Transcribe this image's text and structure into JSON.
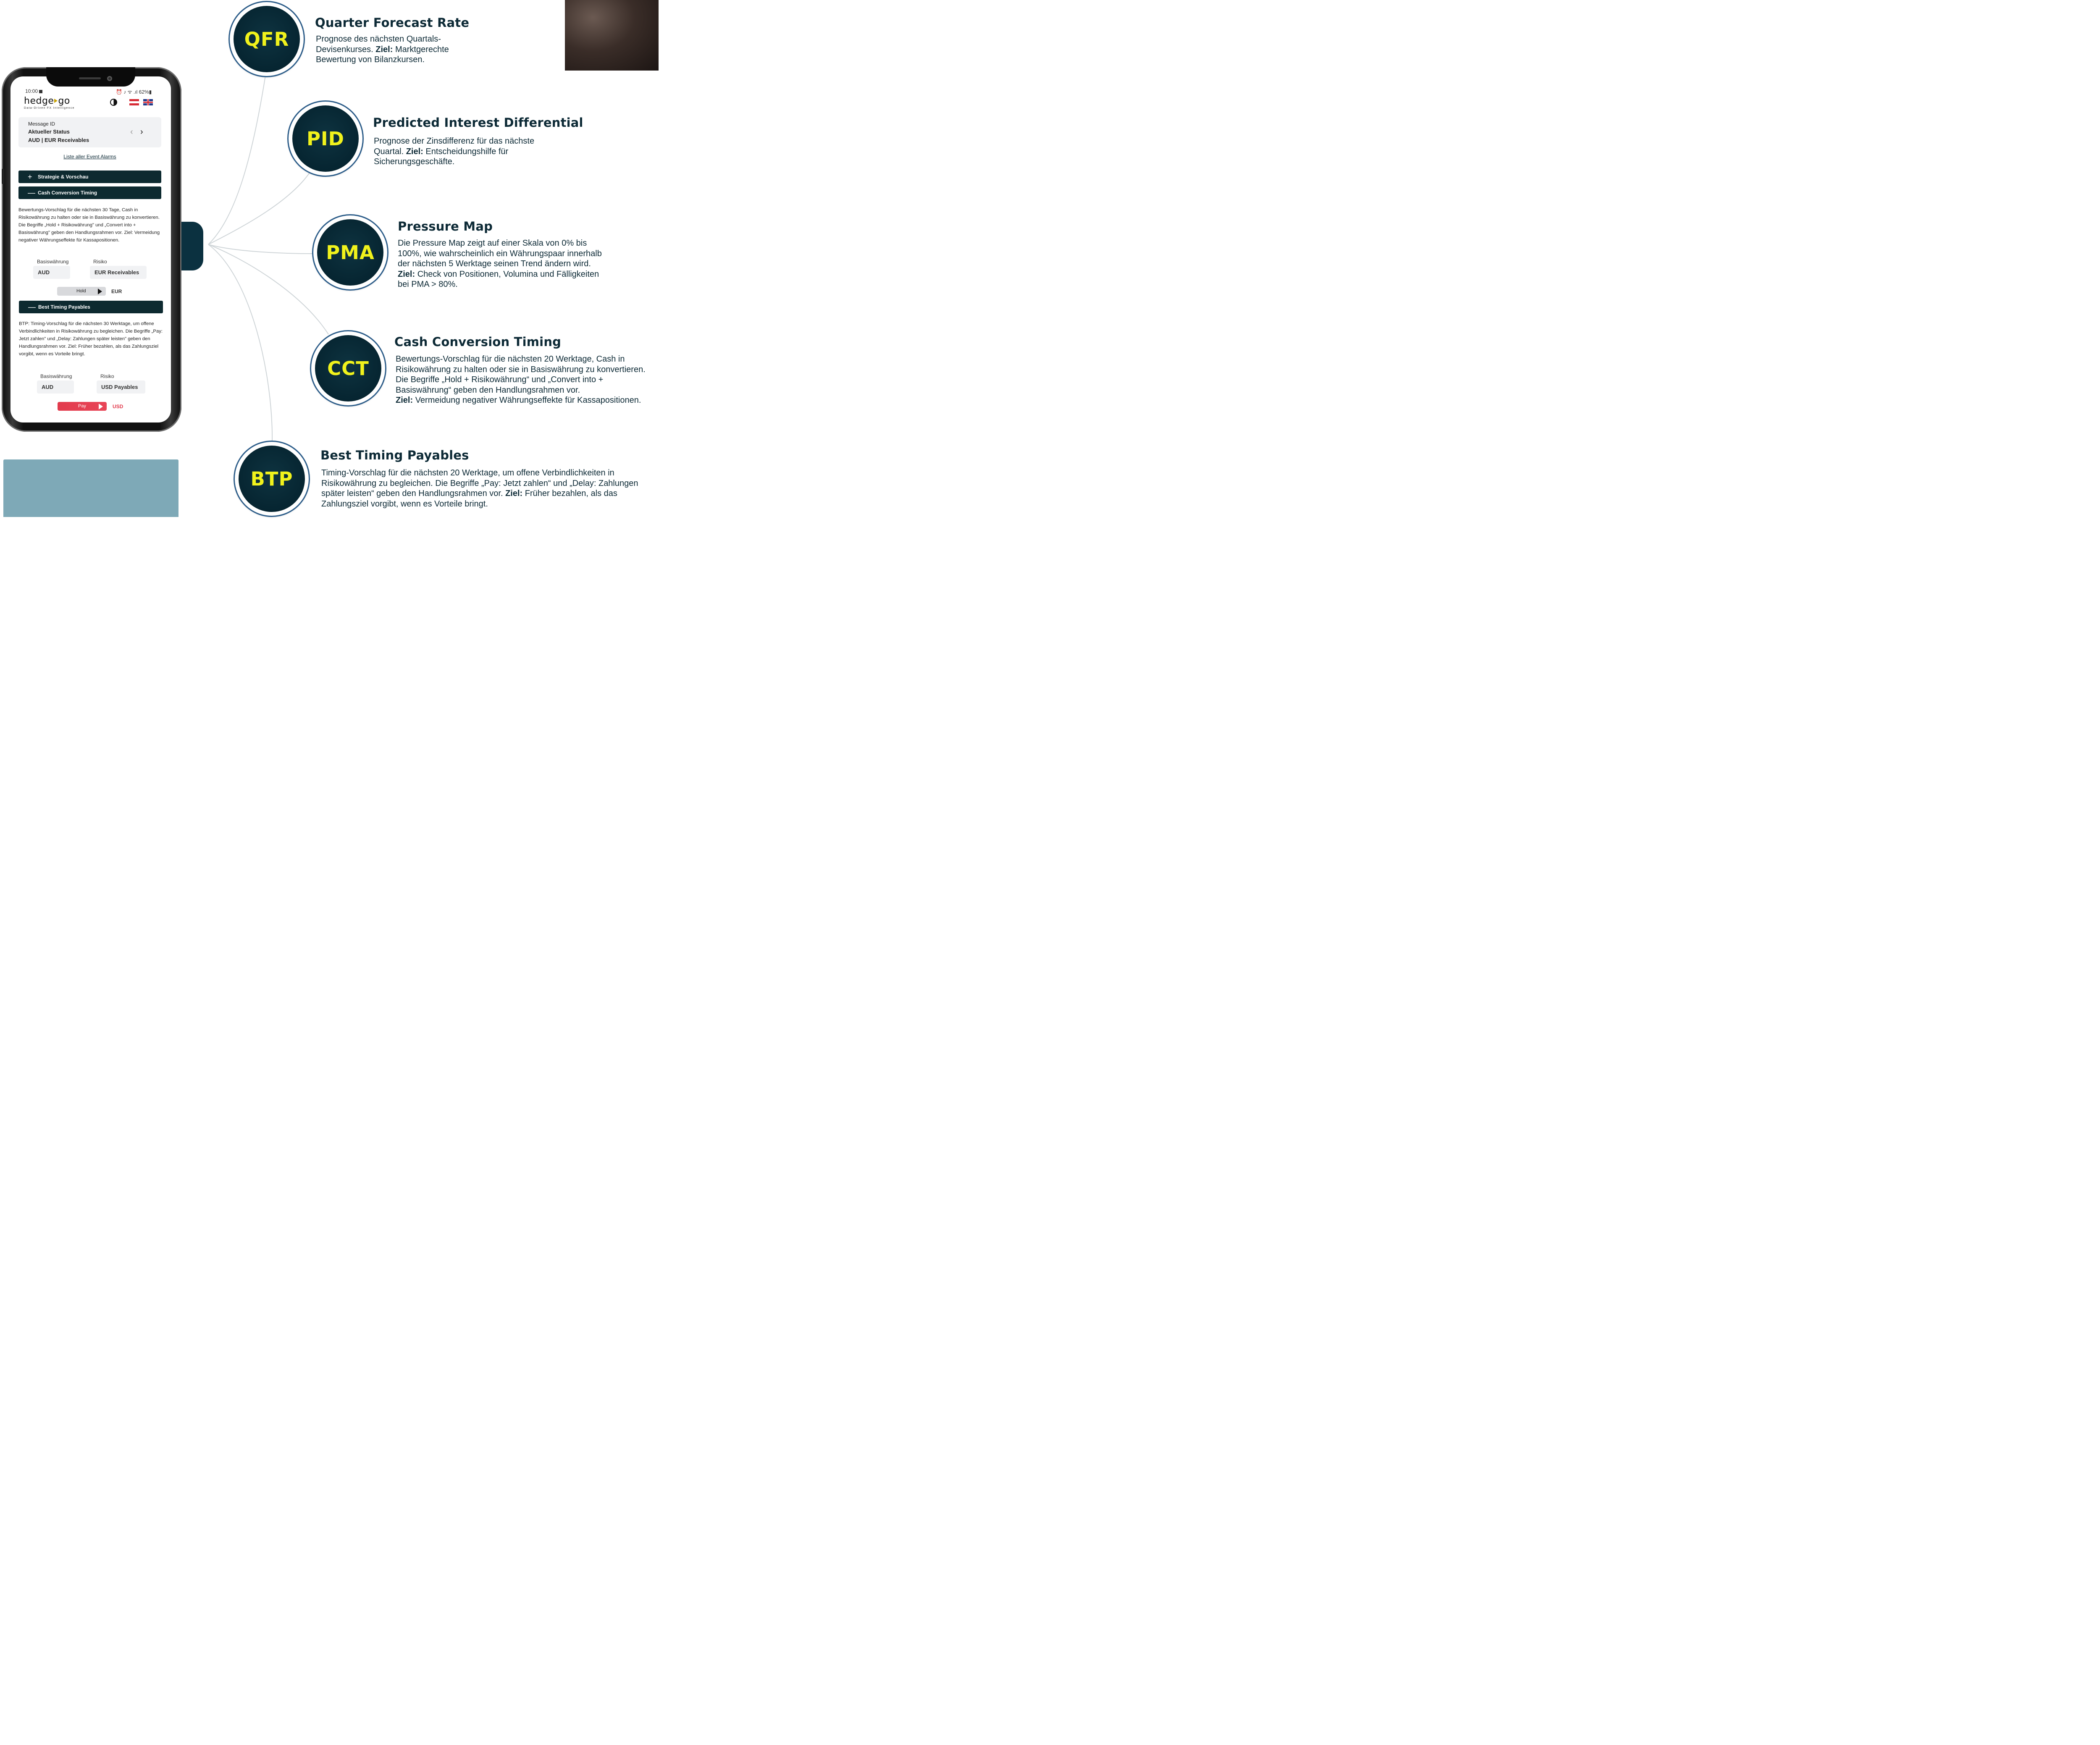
{
  "phone": {
    "status": {
      "time": "10:00",
      "right": "⏰ ♪ ᯤ .ıl 62%▮"
    },
    "logo": {
      "word_left": "hedge",
      "word_right": "go",
      "tagline": "Data-Driven FX Intelligence"
    },
    "message": {
      "label": "Message ID",
      "status": "Aktueller Status",
      "pair": "AUD | EUR Receivables"
    },
    "event_link": "Liste aller Event Alarms",
    "accordion": {
      "strategy": {
        "sign": "+",
        "label": "Strategie & Vorschau"
      },
      "cct": {
        "sign": "—",
        "label": "Cash Conversion Timing"
      },
      "btp": {
        "sign": "—",
        "label": "Best Timing Payables"
      }
    },
    "cct_text": "Bewertungs-Vorschlag für die nächsten 30 Tage, Cash in Risikowährung zu halten oder sie in Basiswährung zu konvertieren. Die Begriffe „Hold + Risikowährung\" und „Convert into + Basiswährung\" geben den Handlungsrahmen vor. Ziel: Vermeidung negativer Währungseffekte für Kassapositionen.",
    "cct_fields": {
      "base_label": "Basiswährung",
      "base_value": "AUD",
      "risk_label": "Risiko",
      "risk_value": "EUR Receivables"
    },
    "hold": {
      "label": "Hold",
      "currency": "EUR"
    },
    "btp_text": "BTP: Timing-Vorschlag für die nächsten 30 Werktage, um offene Verbindlichkeiten in Risikowährung zu begleichen. Die Begriffe „Pay: Jetzt zahlen\" und „Delay: Zahlungen später leisten\" geben den Handlungsrahmen vor. Ziel: Früher bezahlen, als das Zahlungsziel vorgibt, wenn es Vorteile bringt.",
    "btp_fields": {
      "base_label": "Basiswährung",
      "base_value": "AUD",
      "risk_label": "Risiko",
      "risk_value": "USD Payables"
    },
    "pay": {
      "label": "Pay",
      "currency": "USD"
    }
  },
  "sections": {
    "qfr": {
      "abbr": "QFR",
      "title": "Quarter Forecast Rate",
      "text": "Prognose des nächsten Quartals-Devisenkurses.",
      "goal_label": "Ziel:",
      "goal": "Marktgerechte Bewertung von Bilanzkursen."
    },
    "pid": {
      "abbr": "PID",
      "title": "Predicted Interest Differential",
      "text": "Prognose der Zinsdifferenz für das nächste Quartal.",
      "goal_label": "Ziel:",
      "goal": "Entscheidungshilfe für Sicherungsgeschäfte."
    },
    "pma": {
      "abbr": "PMA",
      "title": "Pressure Map",
      "text": "Die Pressure Map zeigt auf einer Skala von 0% bis 100%, wie wahrscheinlich ein Währungspaar innerhalb der nächsten 5 Werktage seinen Trend ändern wird.",
      "goal_label": "Ziel:",
      "goal": "Check von Positionen, Volumina und Fälligkeiten bei PMA > 80%."
    },
    "cct": {
      "abbr": "CCT",
      "title": "Cash Conversion Timing",
      "text": "Bewertungs-Vorschlag für die nächsten 20 Werktage, Cash in Risikowährung zu halten oder sie in Basiswährung zu konvertieren. Die Begriffe „Hold + Risikowährung“ und „Convert into + Basiswährung“ geben den Handlungsrahmen vor.",
      "goal_label": "Ziel:",
      "goal": "Vermeidung negativer Währungseffekte für Kassapositionen."
    },
    "btp": {
      "abbr": "BTP",
      "title": "Best Timing Payables",
      "text": "Timing-Vorschlag für die nächsten 20 Werktage, um offene Verbindlichkeiten in Risikowährung zu begleichen. Die Begriffe „Pay: Jetzt zahlen“ und „Delay: Zahlungen später leisten“ geben den Handlungsrahmen vor.",
      "goal_label": "Ziel:",
      "goal": "Früher bezahlen, als das Zahlungsziel vorgibt, wenn es Vorteile bringt."
    }
  },
  "colors": {
    "navy": "#0d2a36",
    "badge_text": "#f0f21c",
    "ring": "#2e5e8a",
    "pay_red": "#e23b4d",
    "accent_teal": "#7ea9b7"
  }
}
